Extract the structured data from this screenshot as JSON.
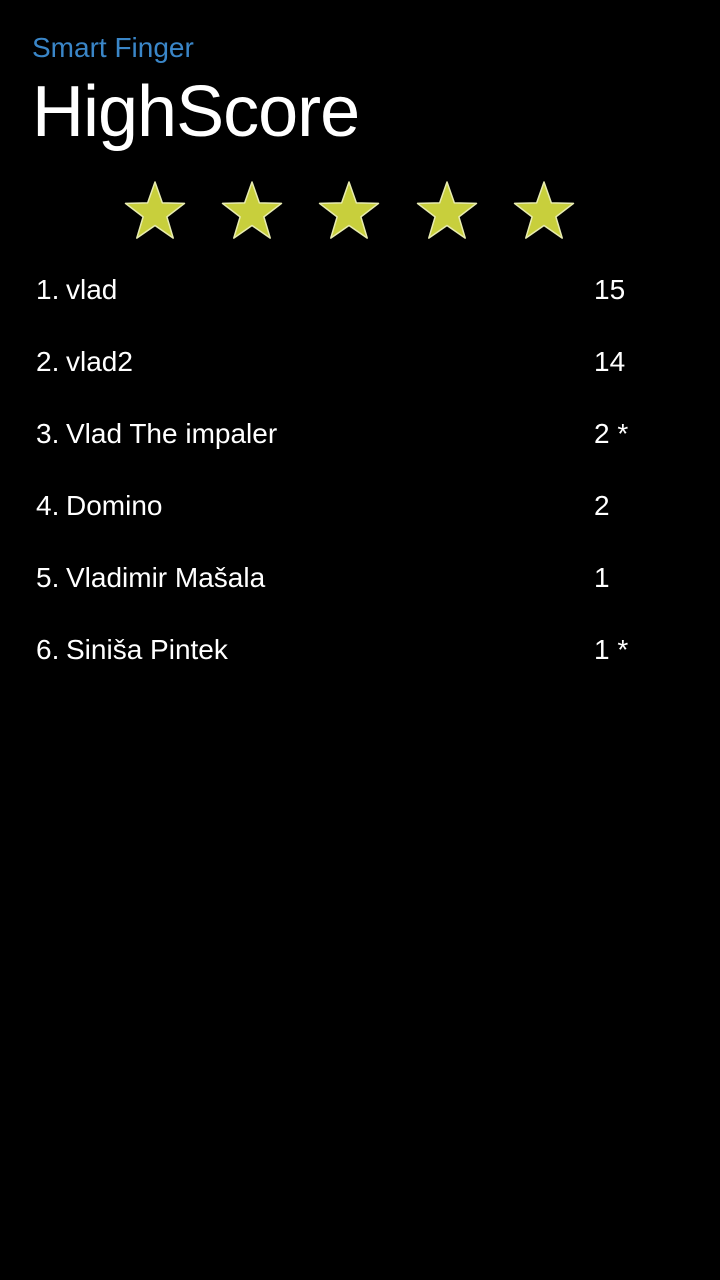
{
  "header": {
    "app_name": "Smart Finger",
    "page_title": "HighScore"
  },
  "rating": {
    "stars_filled": 5,
    "stars_total": 5,
    "star_color": "#c8cf3c",
    "star_outline": "#e8ecb0"
  },
  "high_scores": [
    {
      "rank": "1.",
      "name": "vlad",
      "score": "15"
    },
    {
      "rank": "2.",
      "name": "vlad2",
      "score": "14"
    },
    {
      "rank": "3.",
      "name": "Vlad The impaler",
      "score": "2 *"
    },
    {
      "rank": "4.",
      "name": "Domino",
      "score": "2"
    },
    {
      "rank": "5.",
      "name": "Vladimir Mašala",
      "score": "1"
    },
    {
      "rank": "6.",
      "name": "Siniša Pintek",
      "score": "1 *"
    }
  ],
  "colors": {
    "background": "#000000",
    "accent": "#3a86c8",
    "text": "#ffffff"
  }
}
